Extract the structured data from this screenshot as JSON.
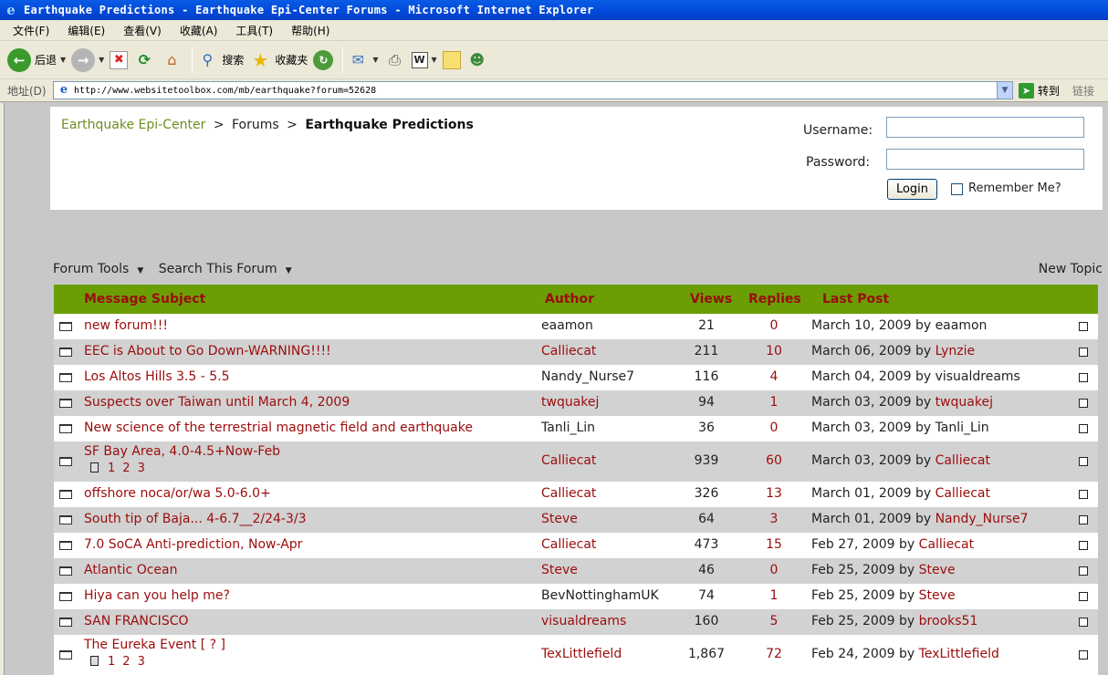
{
  "window": {
    "title": "Earthquake Predictions - Earthquake Epi-Center Forums - Microsoft Internet Explorer",
    "logo_glyph": "e"
  },
  "menu": [
    "文件(F)",
    "编辑(E)",
    "查看(V)",
    "收藏(A)",
    "工具(T)",
    "帮助(H)"
  ],
  "toolbar": {
    "back_label": "后退",
    "search_label": "搜索",
    "favorites_label": "收藏夹"
  },
  "address": {
    "label": "地址(D)",
    "url": "http://www.websitetoolbox.com/mb/earthquake?forum=52628",
    "go_label": "转到",
    "links_label": "链接"
  },
  "breadcrumb": {
    "home": "Earthquake Epi-Center",
    "sep": ">",
    "forums": "Forums",
    "current": "Earthquake Predictions"
  },
  "login": {
    "username_label": "Username:",
    "password_label": "Password:",
    "login_button": "Login",
    "remember_label": "Remember Me?",
    "username_value": "",
    "password_value": ""
  },
  "tools": {
    "forum_tools": "Forum Tools",
    "search_forum": "Search This Forum",
    "new_topic": "New Topic"
  },
  "table": {
    "headers": {
      "subject": "Message Subject",
      "author": "Author",
      "views": "Views",
      "replies": "Replies",
      "last_post": "Last Post"
    },
    "rows": [
      {
        "subject": "new forum!!!",
        "author": "eaamon",
        "views": "21",
        "replies": "0",
        "last_date": "March 10, 2009",
        "by": "by",
        "last_by": "eaamon"
      },
      {
        "subject": "EEC is About to Go Down-WARNING!!!!",
        "author": "Calliecat",
        "views": "211",
        "replies": "10",
        "last_date": "March 06, 2009",
        "by": "by",
        "last_by": "Lynzie"
      },
      {
        "subject": "Los Altos Hills 3.5 - 5.5",
        "author": "Nandy_Nurse7",
        "views": "116",
        "replies": "4",
        "last_date": "March 04, 2009",
        "by": "by",
        "last_by": "visualdreams"
      },
      {
        "subject": "Suspects over Taiwan until March 4, 2009",
        "author": "twquakej",
        "views": "94",
        "replies": "1",
        "last_date": "March 03, 2009",
        "by": "by",
        "last_by": "twquakej"
      },
      {
        "subject": "New science of the terrestrial magnetic field and earthquake",
        "author": "Tanli_Lin",
        "views": "36",
        "replies": "0",
        "last_date": "March 03, 2009",
        "by": "by",
        "last_by": "Tanli_Lin"
      },
      {
        "subject": "SF Bay Area, 4.0-4.5+Now-Feb",
        "author": "Calliecat",
        "views": "939",
        "replies": "60",
        "last_date": "March 03, 2009",
        "by": "by",
        "last_by": "Calliecat",
        "pages": [
          "1",
          "2",
          "3"
        ]
      },
      {
        "subject": "offshore noca/or/wa 5.0-6.0+",
        "author": "Calliecat",
        "views": "326",
        "replies": "13",
        "last_date": "March 01, 2009",
        "by": "by",
        "last_by": "Calliecat"
      },
      {
        "subject": "South tip of Baja... 4-6.7__2/24-3/3",
        "author": "Steve",
        "views": "64",
        "replies": "3",
        "last_date": "March 01, 2009",
        "by": "by",
        "last_by": "Nandy_Nurse7"
      },
      {
        "subject": "7.0 SoCA Anti-prediction, Now-Apr",
        "author": "Calliecat",
        "views": "473",
        "replies": "15",
        "last_date": "Feb 27, 2009",
        "by": "by",
        "last_by": "Calliecat"
      },
      {
        "subject": "Atlantic Ocean",
        "author": "Steve",
        "views": "46",
        "replies": "0",
        "last_date": "Feb 25, 2009",
        "by": "by",
        "last_by": "Steve"
      },
      {
        "subject": "Hiya can you help me?",
        "author": "BevNottinghamUK",
        "views": "74",
        "replies": "1",
        "last_date": "Feb 25, 2009",
        "by": "by",
        "last_by": "Steve"
      },
      {
        "subject": "SAN FRANCISCO",
        "author": "visualdreams",
        "views": "160",
        "replies": "5",
        "last_date": "Feb 25, 2009",
        "by": "by",
        "last_by": "brooks51"
      },
      {
        "subject": "The Eureka Event [ ? ]",
        "author": "TexLittlefield",
        "views": "1,867",
        "replies": "72",
        "last_date": "Feb 24, 2009",
        "by": "by",
        "last_by": "TexLittlefield",
        "pages": [
          "1",
          "2",
          "3"
        ]
      }
    ]
  },
  "colors": {
    "header_bg": "#6b9e05",
    "link_red": "#9b0c0c",
    "breadcrumb_green": "#6b8e23",
    "row_alt": "#d2d2d2"
  }
}
